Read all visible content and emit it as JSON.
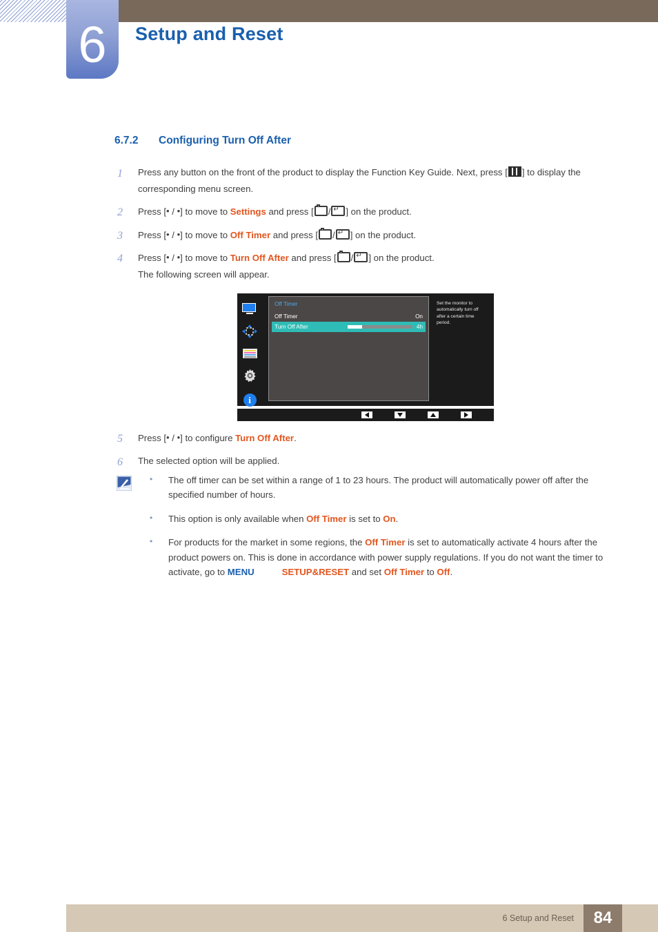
{
  "header": {
    "chapter_number": "6",
    "chapter_title": "Setup and Reset"
  },
  "section": {
    "number": "6.7.2",
    "title": "Configuring Turn Off After"
  },
  "steps": [
    {
      "num": "1",
      "part1": "Press any button on the front of the product to display the Function Key Guide. Next, press [",
      "part2": "] to display the corresponding menu screen."
    },
    {
      "num": "2",
      "pre": "Press [",
      "keys": " / ",
      "mid": "] to move to ",
      "target": "Settings",
      "mid2": " and press [",
      "post": "] on the product."
    },
    {
      "num": "3",
      "pre": "Press [",
      "keys": " / ",
      "mid": "] to move to ",
      "target": "Off Timer",
      "mid2": " and press [",
      "post": "] on the product."
    },
    {
      "num": "4",
      "pre": "Press [",
      "keys": " / ",
      "mid": "] to move to ",
      "target": "Turn Off After",
      "mid2": " and press [",
      "post": "] on the product.",
      "extra": "The following screen will appear."
    },
    {
      "num": "5",
      "pre": "Press [",
      "keys": " / ",
      "mid": "] to configure ",
      "target": "Turn Off After",
      "post": "."
    },
    {
      "num": "6",
      "text": "The selected option will be applied."
    }
  ],
  "osd": {
    "title": "Off Timer",
    "sidebar_icons": [
      "monitor-icon",
      "move-arrows-icon",
      "color-bars-icon",
      "gear-icon",
      "info-icon"
    ],
    "rows": [
      {
        "label": "Off Timer",
        "value": "On",
        "highlighted": false,
        "has_slider": false
      },
      {
        "label": "Turn Off After",
        "value": "4h",
        "highlighted": true,
        "has_slider": true,
        "slider_percent": 22
      }
    ],
    "description": "Set the monitor to automatically turn off after a certain time period.",
    "nav_buttons": [
      "left-arrow",
      "down-arrow",
      "up-arrow",
      "right-arrow"
    ],
    "colors": {
      "highlight": "#2fbcb6",
      "panel": "#4b4746",
      "background": "#1b1b1b",
      "title": "#4fa8e8"
    }
  },
  "notes": [
    {
      "text": "The off timer can be set within a range of 1 to 23 hours. The product will automatically power off after the specified number of hours."
    },
    {
      "pre": "This option is only available when ",
      "t1": "Off Timer",
      "mid": " is set to ",
      "t2": "On",
      "post": "."
    },
    {
      "pre": "For products for the market in some regions, the ",
      "t1": "Off Timer",
      "mid": " is set to automatically activate 4 hours after the product powers on. This is done in accordance with power supply regulations. If you do not want the timer to activate, go to ",
      "t2": "MENU",
      "t3": "SETUP&RESET",
      "mid2": " and set ",
      "t4": "Off Timer",
      "mid3": " to ",
      "t5": "Off",
      "post": "."
    }
  ],
  "footer": {
    "label": "6 Setup and Reset",
    "page": "84"
  }
}
